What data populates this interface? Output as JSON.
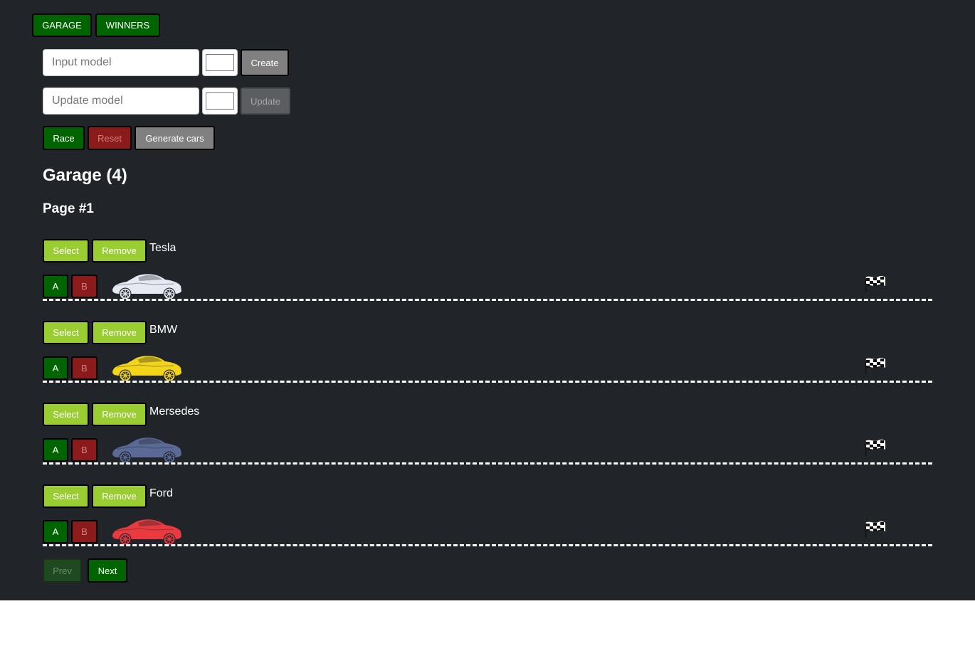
{
  "nav": {
    "garage": "GARAGE",
    "winners": "WINNERS"
  },
  "create": {
    "placeholder": "Input model",
    "button": "Create",
    "color": "#ffffff"
  },
  "update": {
    "placeholder": "Update model",
    "button": "Update",
    "color": "#ffffff"
  },
  "controls": {
    "race": "Race",
    "reset": "Reset",
    "generate": "Generate cars"
  },
  "garage": {
    "title": "Garage (4)",
    "page": "Page #1"
  },
  "car_actions": {
    "select": "Select",
    "remove": "Remove",
    "start": "A",
    "stop": "B"
  },
  "cars": [
    {
      "name": "Tesla",
      "color": "#e6e8f2"
    },
    {
      "name": "BMW",
      "color": "#f2d41a"
    },
    {
      "name": "Mersedes",
      "color": "#5a6a96"
    },
    {
      "name": "Ford",
      "color": "#e83a3f"
    }
  ],
  "pagination": {
    "prev": "Prev",
    "next": "Next"
  },
  "icons": {
    "car": "car-icon",
    "finish": "checkered-flag-icon"
  }
}
